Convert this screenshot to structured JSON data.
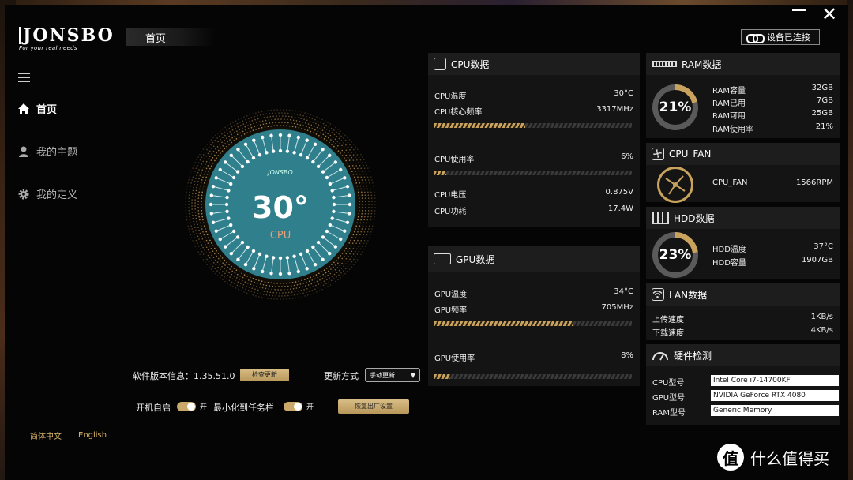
{
  "window": {
    "close_glyph": "✕"
  },
  "brand": {
    "logo_text": "JONSBO",
    "tagline": "For your real needs"
  },
  "page_tab": "首页",
  "connection": {
    "status": "设备已连接",
    "icon": "link-icon"
  },
  "sidebar": {
    "items": [
      {
        "label": "首页",
        "icon": "home-icon",
        "active": true
      },
      {
        "label": "我的主题",
        "icon": "user-icon",
        "active": false
      },
      {
        "label": "我的定义",
        "icon": "gear-icon",
        "active": false
      }
    ]
  },
  "language": {
    "zh": "简体中文",
    "en": "English"
  },
  "gauge": {
    "brand": "JONSBO",
    "value": "30°",
    "label": "CPU",
    "accent": "#2f7f8c"
  },
  "settings": {
    "version_label": "软件版本信息：1.35.51.0",
    "check_update": "检查更新",
    "update_mode_label": "更新方式",
    "update_mode_value": "手动更新",
    "autostart_label": "开机自启",
    "autostart_state": "开",
    "minimize_label": "最小化到任务栏",
    "minimize_state": "开",
    "reset_button": "恢复出厂设置"
  },
  "cpu": {
    "title": "CPU数据",
    "temp_label": "CPU温度",
    "temp_value": "30°C",
    "freq_label": "CPU核心频率",
    "freq_value": "3317MHz",
    "freq_fill": 0.46,
    "usage_label": "CPU使用率",
    "usage_value": "6%",
    "usage_fill": 0.06,
    "voltage_label": "CPU电压",
    "voltage_value": "0.875V",
    "power_label": "CPU功耗",
    "power_value": "17.4W"
  },
  "gpu": {
    "title": "GPU数据",
    "temp_label": "GPU温度",
    "temp_value": "34°C",
    "freq_label": "GPU频率",
    "freq_value": "705MHz",
    "freq_fill": 0.7,
    "usage_label": "GPU使用率",
    "usage_value": "8%",
    "usage_fill": 0.08
  },
  "ram": {
    "title": "RAM数据",
    "percent": "21%",
    "percent_fill": 0.21,
    "capacity_label": "RAM容量",
    "capacity_value": "32GB",
    "used_label": "RAM已用",
    "used_value": "7GB",
    "free_label": "RAM可用",
    "free_value": "25GB",
    "usage_label": "RAM使用率",
    "usage_value": "21%"
  },
  "fan": {
    "title": "CPU_FAN",
    "label": "CPU_FAN",
    "value": "1566RPM"
  },
  "hdd": {
    "title": "HDD数据",
    "percent": "23%",
    "percent_fill": 0.23,
    "temp_label": "HDD温度",
    "temp_value": "37°C",
    "capacity_label": "HDD容量",
    "capacity_value": "1907GB"
  },
  "lan": {
    "title": "LAN数据",
    "up_label": "上传速度",
    "up_value": "1KB/s",
    "down_label": "下载速度",
    "down_value": "4KB/s"
  },
  "hardware": {
    "title": "硬件检测",
    "cpu_label": "CPU型号",
    "cpu_value": "Intel Core i7-14700KF",
    "gpu_label": "GPU型号",
    "gpu_value": "NVIDIA GeForce RTX 4080",
    "ram_label": "RAM型号",
    "ram_value": "Generic Memory"
  },
  "watermark": {
    "glyph": "值",
    "text": "什么值得买"
  },
  "colors": {
    "gold": "#c9a35e",
    "teal": "#2f7f8c"
  }
}
